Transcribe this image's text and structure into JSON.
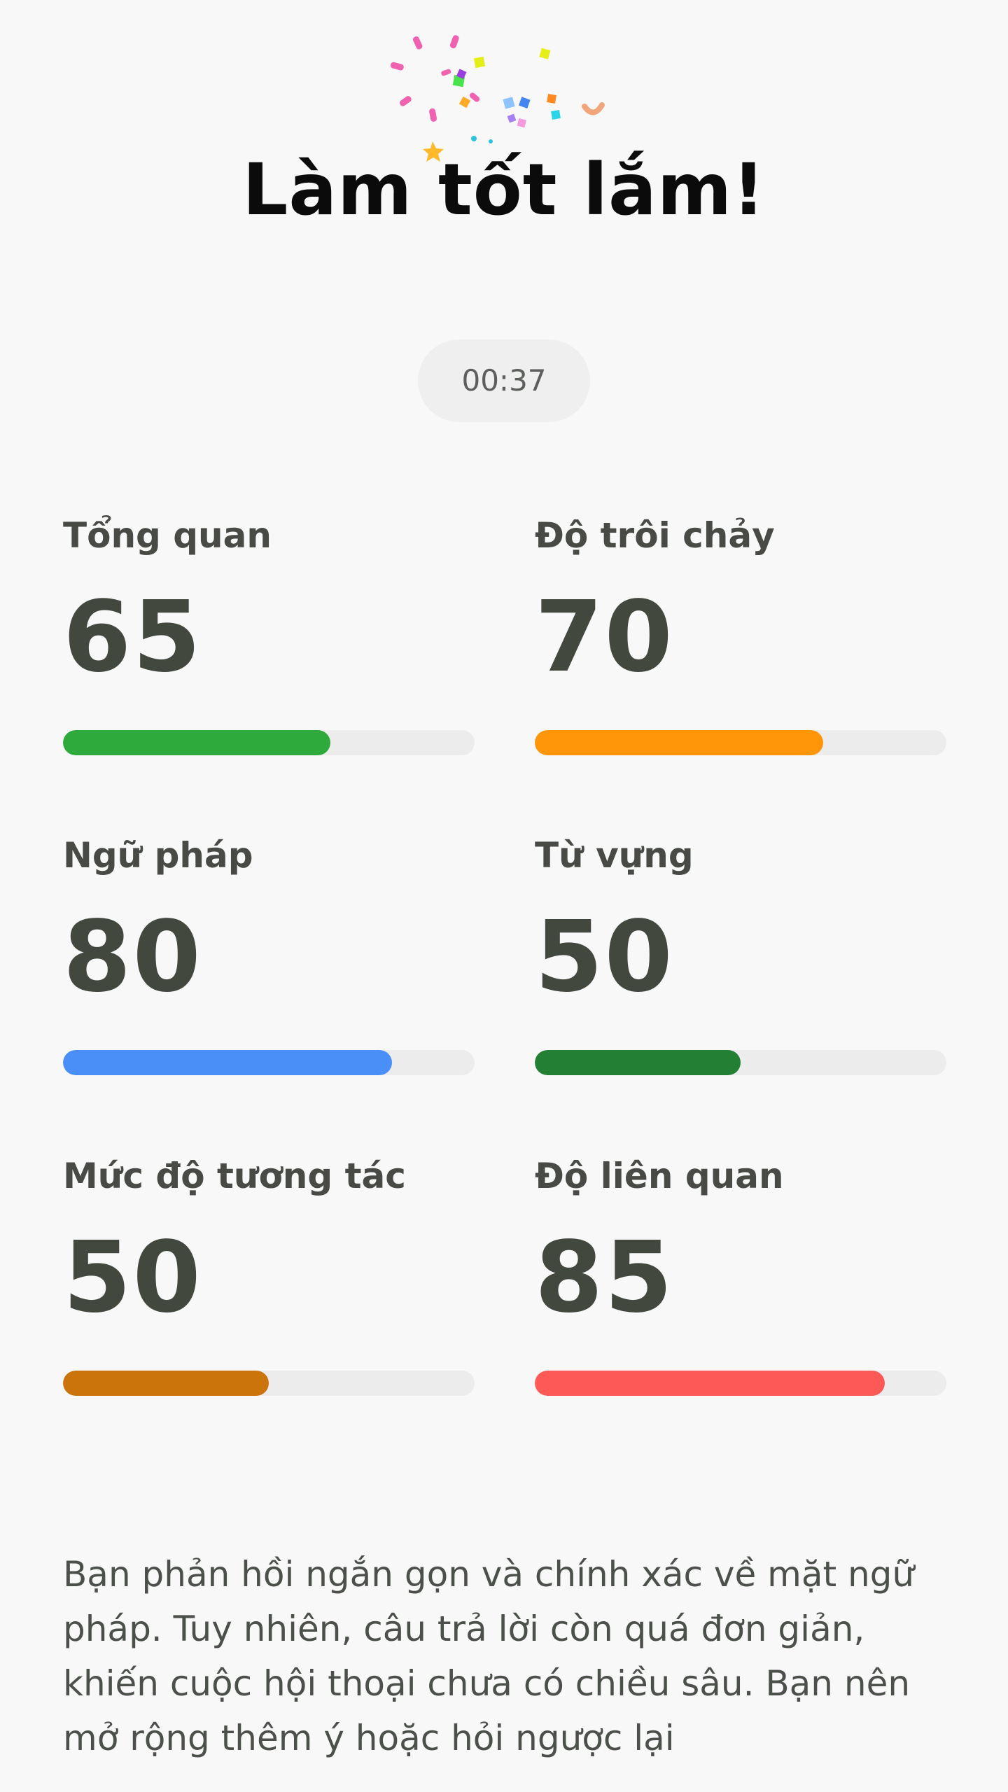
{
  "header": {
    "title": "Làm tốt lắm!"
  },
  "timer": {
    "value": "00:37"
  },
  "metrics": [
    {
      "label": "Tổng quan",
      "value": "65",
      "progress": 0.65,
      "color": "#2eaa3d"
    },
    {
      "label": "Độ trôi chảy",
      "value": "70",
      "progress": 0.7,
      "color": "#ff9508"
    },
    {
      "label": "Ngữ pháp",
      "value": "80",
      "progress": 0.8,
      "color": "#4a8ff8"
    },
    {
      "label": "Từ vựng",
      "value": "50",
      "progress": 0.5,
      "color": "#227f34"
    },
    {
      "label": "Mức độ tương tác",
      "value": "50",
      "progress": 0.5,
      "color": "#cc740c"
    },
    {
      "label": "Độ liên quan",
      "value": "85",
      "progress": 0.85,
      "color": "#fc5957"
    }
  ],
  "feedback": {
    "text": "Bạn phản hồi ngắn gọn và chính xác về mặt ngữ pháp. Tuy nhiên, câu trả lời còn quá đơn giản, khiến cuộc hội thoại chưa có chiều sâu. Bạn nên mở rộng thêm ý hoặc hỏi ngược lại"
  },
  "decorations": {
    "confetti_icon": "confetti-icon"
  }
}
